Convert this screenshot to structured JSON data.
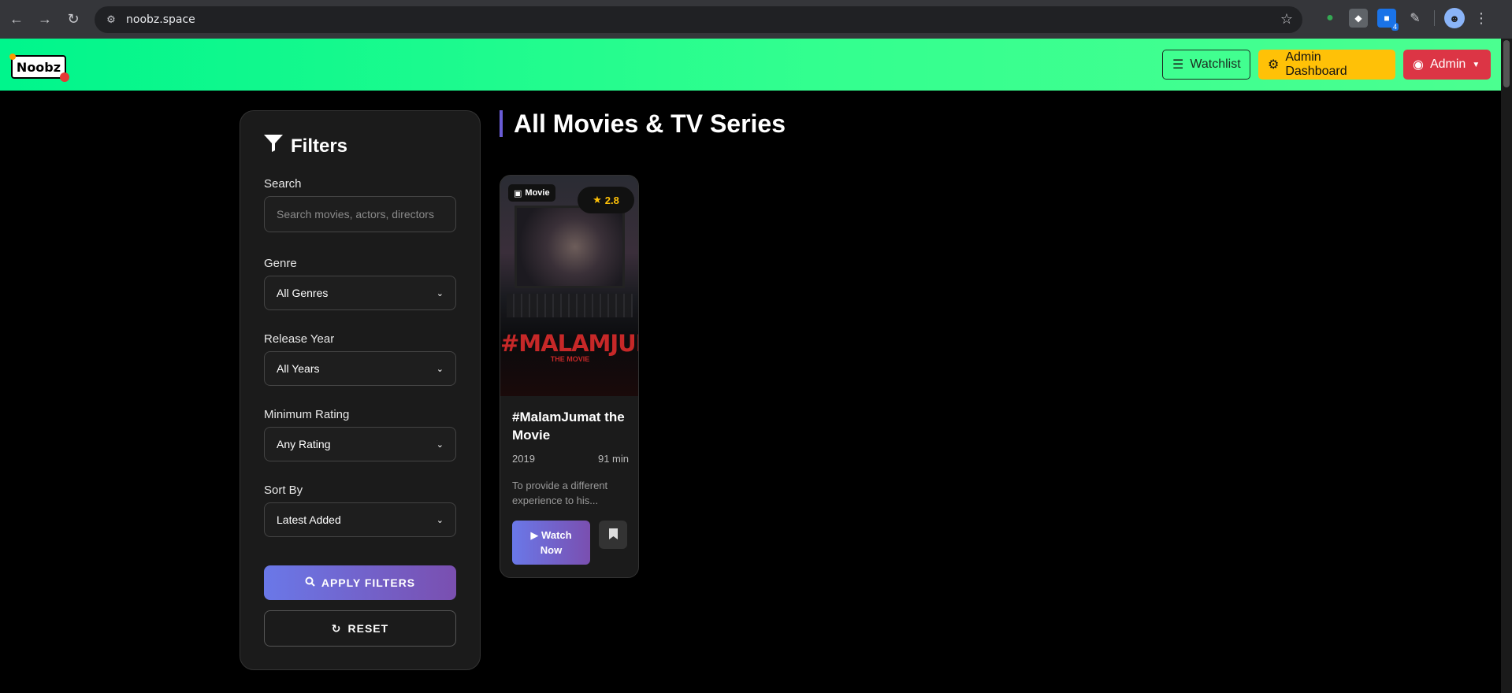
{
  "browser": {
    "url": "noobz.space",
    "back_icon": "arrow-left-icon",
    "forward_icon": "arrow-right-icon",
    "reload_icon": "reload-icon",
    "extension_badge": "4"
  },
  "header": {
    "logo_text": "Noobz",
    "watchlist_label": "Watchlist",
    "admin_dashboard_label": "Admin Dashboard",
    "admin_label": "Admin",
    "colors": {
      "gradient_start": "#00f58c",
      "gradient_end": "#4bff90",
      "admin_dashboard": "#ffc107",
      "admin": "#dc3545"
    }
  },
  "filters": {
    "title": "Filters",
    "search": {
      "label": "Search",
      "placeholder": "Search movies, actors, directors"
    },
    "genre": {
      "label": "Genre",
      "selected": "All Genres"
    },
    "year": {
      "label": "Release Year",
      "selected": "All Years"
    },
    "rating": {
      "label": "Minimum Rating",
      "selected": "Any Rating"
    },
    "sort": {
      "label": "Sort By",
      "selected": "Latest Added"
    },
    "apply_label": "APPLY FILTERS",
    "reset_label": "RESET"
  },
  "main": {
    "heading": "All Movies & TV Series",
    "movies": [
      {
        "type": "Movie",
        "rating": "2.8",
        "poster_title": "#MALAMJUMAT",
        "poster_subtitle": "THE MOVIE",
        "title": "#MalamJumat the Movie",
        "year": "2019",
        "duration": "91 min",
        "description": "To provide a different experience to his...",
        "watch_label": "Watch Now"
      }
    ]
  }
}
